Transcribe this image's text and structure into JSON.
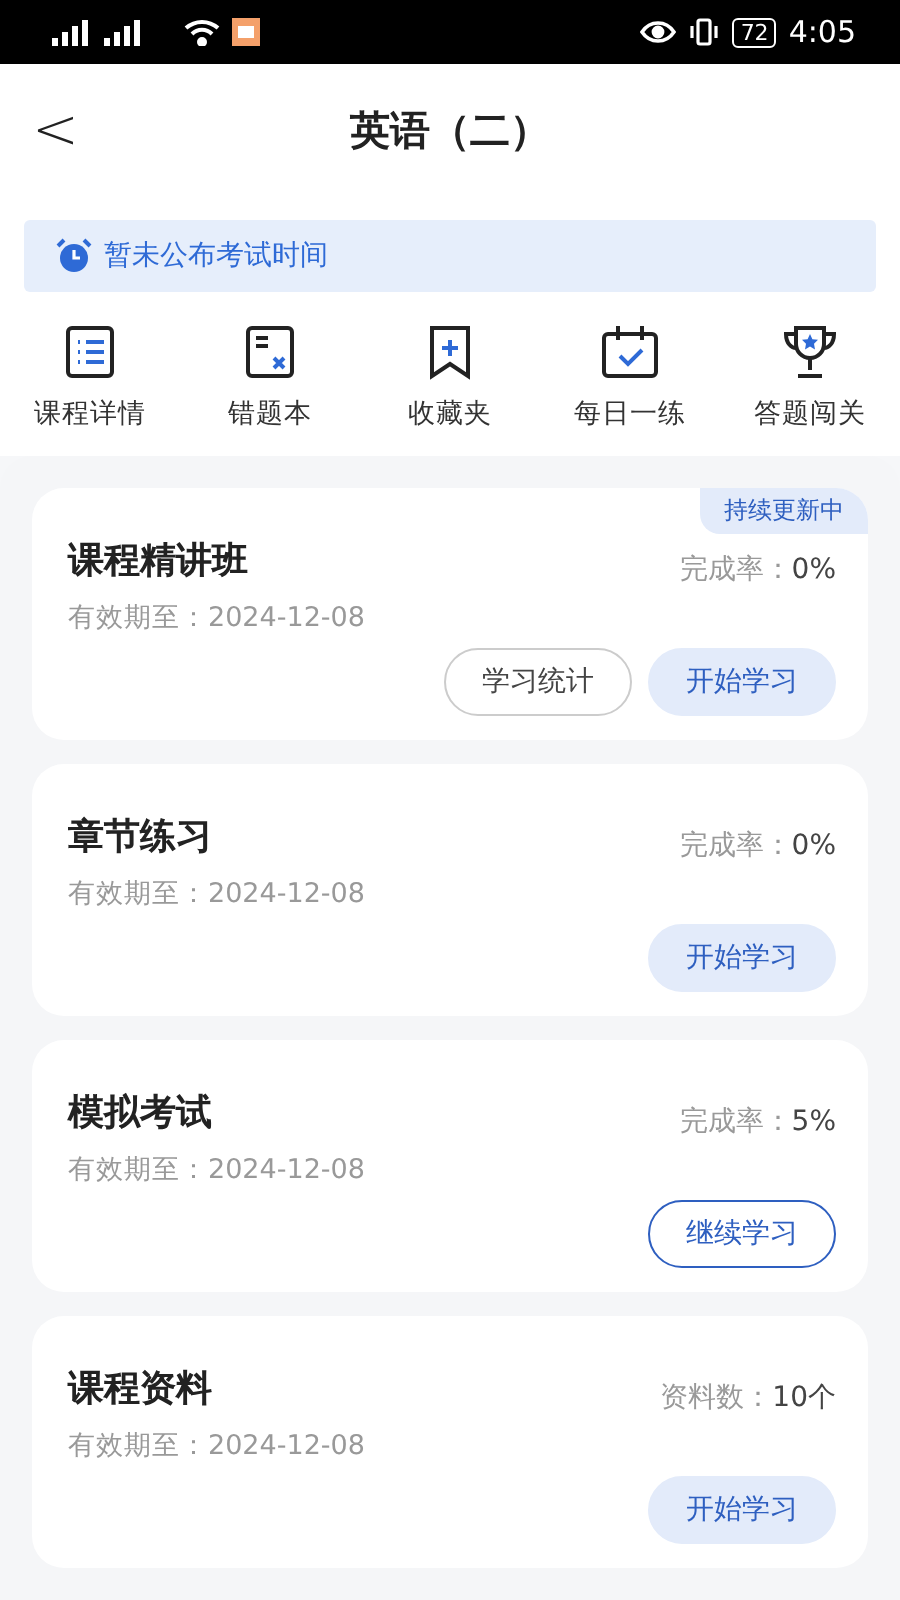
{
  "status_bar": {
    "battery": "72",
    "time": "4:05"
  },
  "header": {
    "back": "<",
    "title": "英语（二）"
  },
  "notice": {
    "text": "暂未公布考试时间"
  },
  "shortcuts": [
    {
      "label": "课程详情",
      "kind": "list"
    },
    {
      "label": "错题本",
      "kind": "wrong"
    },
    {
      "label": "收藏夹",
      "kind": "bookmark"
    },
    {
      "label": "每日一练",
      "kind": "calendar"
    },
    {
      "label": "答题闯关",
      "kind": "trophy"
    }
  ],
  "cards": [
    {
      "title": "课程精讲班",
      "badge": "持续更新中",
      "expiry": "有效期至：2024-12-08",
      "stat_label": "完成率：",
      "stat_value": "0%",
      "buttons": [
        {
          "label": "学习统计",
          "kind": "plain"
        },
        {
          "label": "开始学习",
          "kind": "filled"
        }
      ]
    },
    {
      "title": "章节练习",
      "expiry": "有效期至：2024-12-08",
      "stat_label": "完成率：",
      "stat_value": "0%",
      "buttons": [
        {
          "label": "开始学习",
          "kind": "filled"
        }
      ]
    },
    {
      "title": "模拟考试",
      "expiry": "有效期至：2024-12-08",
      "stat_label": "完成率：",
      "stat_value": "5%",
      "buttons": [
        {
          "label": "继续学习",
          "kind": "outline"
        }
      ]
    },
    {
      "title": "课程资料",
      "expiry": "有效期至：2024-12-08",
      "stat_label": "资料数：",
      "stat_value": "10个",
      "buttons": [
        {
          "label": "开始学习",
          "kind": "filled"
        }
      ]
    }
  ]
}
